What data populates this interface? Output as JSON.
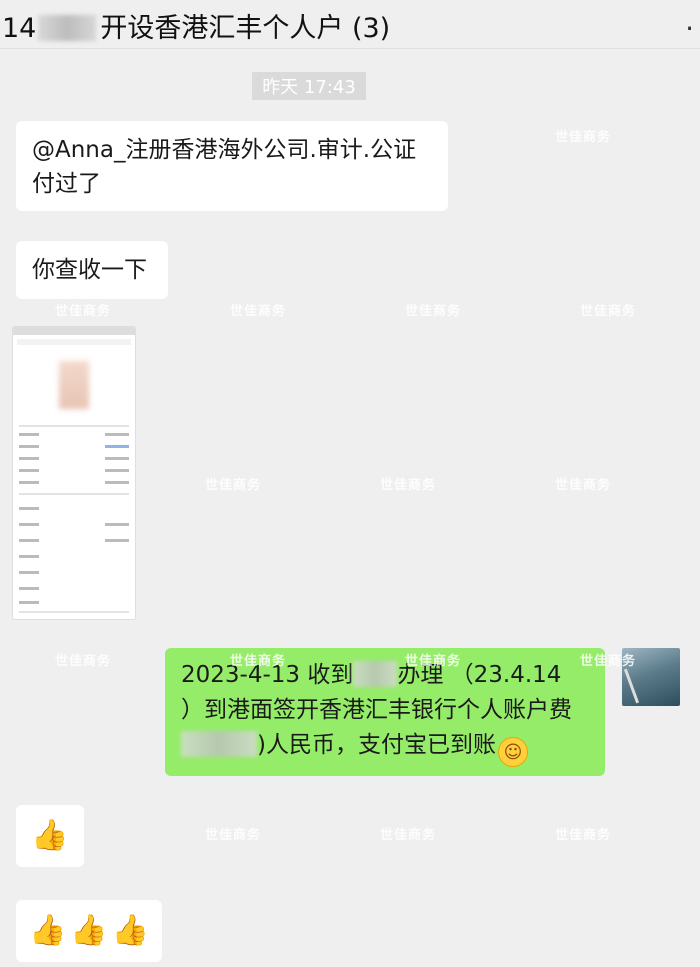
{
  "header": {
    "title_prefix": "14",
    "title_suffix": "开设香港汇丰个人户 (3)",
    "more_label": "."
  },
  "timestamp": "昨天 17:43",
  "messages": {
    "msg1": {
      "line1": "@Anna_注册香港海外公司.审计.公证",
      "line2": "付过了"
    },
    "msg2": {
      "text": "你查收一下"
    },
    "msg4": {
      "line1_a": "2023-4-13 收到",
      "line1_b": "办理 （23.4.14",
      "line2": "）到港面签开香港汇丰银行个人账户费",
      "line3_b": ")人民币，支付宝已到账"
    }
  },
  "emoji": {
    "smile": "☺",
    "thumbs": "👍"
  },
  "watermark": "世佳商务",
  "colors": {
    "background": "#efefef",
    "bubble_incoming": "#ffffff",
    "bubble_outgoing": "#95ec69",
    "timestamp_bg": "#dadada"
  }
}
